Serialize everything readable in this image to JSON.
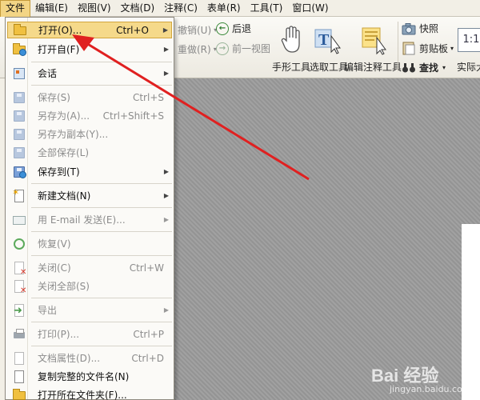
{
  "menubar": {
    "items": [
      "文件",
      "编辑(E)",
      "视图(V)",
      "文档(D)",
      "注释(C)",
      "表单(R)",
      "工具(T)",
      "窗口(W)"
    ]
  },
  "toolbar": {
    "undo": "撤销(U)",
    "redo": "重做(R)",
    "back": "后退",
    "prev_view": "前一视图",
    "hand_tool": "手形工具",
    "select_tool": "选取工具",
    "annot_tool": "编辑注释工具",
    "snapshot": "快照",
    "clipboard": "剪贴板",
    "find": "查找",
    "actual_size": "实际大",
    "actual_size_icon": "1:1"
  },
  "file_menu": {
    "open": {
      "label": "打开(O)...",
      "shortcut": "Ctrl+O"
    },
    "open_from": {
      "label": "打开自(F)"
    },
    "session": {
      "label": "会话"
    },
    "save": {
      "label": "保存(S)",
      "shortcut": "Ctrl+S"
    },
    "save_as": {
      "label": "另存为(A)...",
      "shortcut": "Ctrl+Shift+S"
    },
    "save_copy": {
      "label": "另存为副本(Y)..."
    },
    "save_all": {
      "label": "全部保存(L)"
    },
    "save_to": {
      "label": "保存到(T)"
    },
    "new_doc": {
      "label": "新建文档(N)"
    },
    "email": {
      "label": "用 E-mail 发送(E)..."
    },
    "revert": {
      "label": "恢复(V)"
    },
    "close": {
      "label": "关闭(C)",
      "shortcut": "Ctrl+W"
    },
    "close_all": {
      "label": "关闭全部(S)"
    },
    "export": {
      "label": "导出"
    },
    "print": {
      "label": "打印(P)...",
      "shortcut": "Ctrl+P"
    },
    "properties": {
      "label": "文档属性(D)...",
      "shortcut": "Ctrl+D"
    },
    "copy_name": {
      "label": "复制完整的文件名(N)"
    },
    "open_folder": {
      "label": "打开所在文件夹(F)..."
    }
  },
  "watermark": {
    "brand": "Bai 经验",
    "url": "jingyan.baidu.com"
  },
  "colors": {
    "highlight": "#f5d98a",
    "annotation_arrow": "#e02020"
  }
}
